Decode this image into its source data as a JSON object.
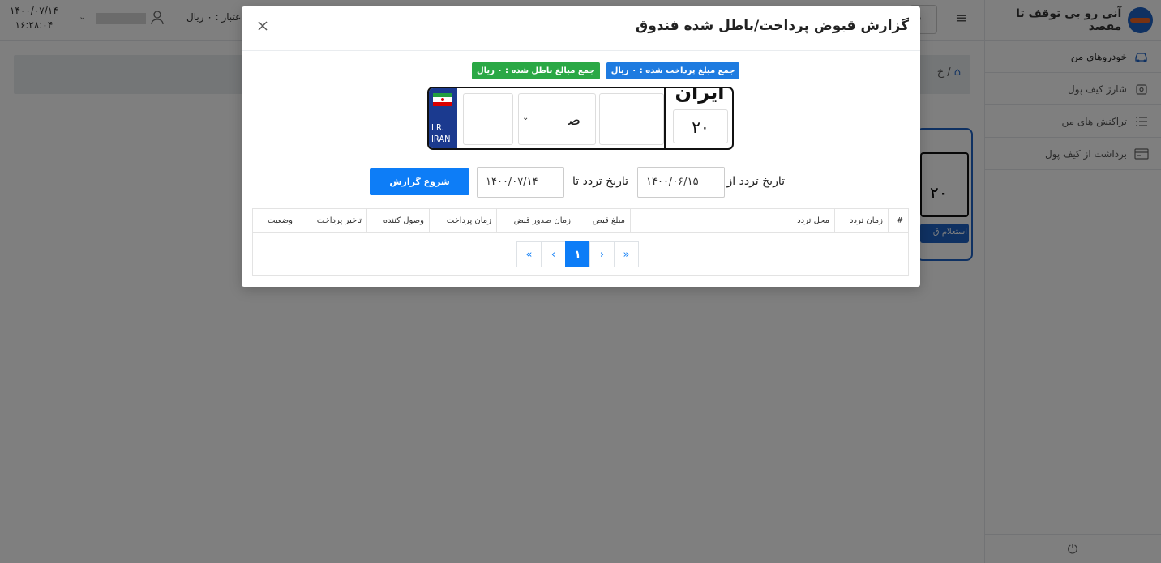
{
  "app": {
    "brand_name": "آنی رو بی توقف تا مقصد",
    "clock_date": "۱۴۰۰/۰۷/۱۴",
    "clock_time": "۱۶:۲۸:۰۴",
    "credit": "اعتبار : ۰ ریال",
    "top_search_label": "قا",
    "breadcrumb": "/ خ"
  },
  "sidebar": {
    "items": [
      {
        "label": "خودروهای من",
        "icon": "car-icon"
      },
      {
        "label": "شارژ کیف پول",
        "icon": "wallet-icon"
      },
      {
        "label": "تراکنش های من",
        "icon": "list-icon"
      },
      {
        "label": "برداشت از کیف پول",
        "icon": "card-icon"
      }
    ]
  },
  "background_card": {
    "plate_number": "۲۰",
    "button_label": "استعلام ق"
  },
  "modal": {
    "title": "گزارش قبوض پرداخت/باطل شده فندوق",
    "badge_paid": "جمع مبلغ پرداخت شده : ۰ ریال",
    "badge_void": "جمع مبالغ باطل شده : ۰ ریال",
    "plate": {
      "flag_text_1": "I.R.",
      "flag_text_2": "IRAN",
      "letter": "ﺻ",
      "iran_label": "ایران",
      "region_code": "۲۰"
    },
    "date_from_label": "تاریخ تردد از",
    "date_from_value": "۱۴۰۰/۰۶/۱۵",
    "date_to_label": "تاریخ تردد تا",
    "date_to_value": "۱۴۰۰/۰۷/۱۴",
    "start_button": "شروع گزارش",
    "table": {
      "columns": [
        "#",
        "زمان تردد",
        "محل تردد",
        "مبلغ قبض",
        "زمان صدور قبض",
        "زمان پرداخت",
        "وصول کننده",
        "تاخیر پرداخت",
        "وضعیت"
      ],
      "rows": []
    },
    "pagination": {
      "first": "«",
      "prev": "‹",
      "current": "۱",
      "next": "›",
      "last": "»"
    }
  }
}
